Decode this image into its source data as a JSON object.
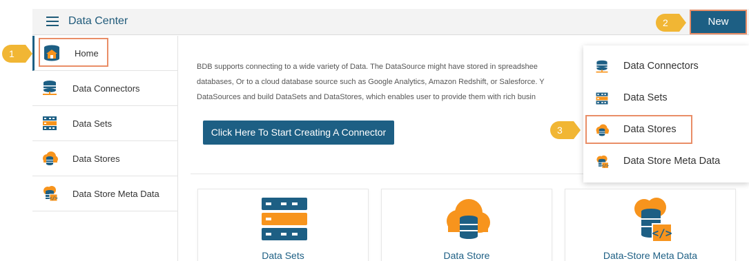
{
  "header": {
    "title": "Data Center",
    "new_button": "New"
  },
  "callouts": [
    "1",
    "2",
    "3"
  ],
  "sidebar": {
    "items": [
      {
        "label": "Home",
        "icon": "home-db-icon",
        "active": true
      },
      {
        "label": "Data Connectors",
        "icon": "data-connectors-icon"
      },
      {
        "label": "Data Sets",
        "icon": "data-sets-icon"
      },
      {
        "label": "Data Stores",
        "icon": "data-stores-icon"
      },
      {
        "label": "Data Store Meta Data",
        "icon": "data-store-meta-icon"
      }
    ]
  },
  "main": {
    "intro_lines": [
      "BDB supports connecting to a wide variety of Data. The DataSource might have stored in spreadshee",
      "databases, Or to a cloud database source such as Google Analytics, Amazon Redshift, or Salesforce. Y",
      "DataSources and build DataSets and DataStores, which enables user to provide them with rich busin"
    ],
    "cta_label": "Click Here To Start Creating A Connector",
    "cards": [
      {
        "label": "Data Sets",
        "icon": "data-sets-icon"
      },
      {
        "label": "Data Store",
        "icon": "data-store-icon"
      },
      {
        "label": "Data-Store Meta Data",
        "icon": "data-store-meta-icon"
      }
    ]
  },
  "new_menu": {
    "items": [
      {
        "label": "Data Connectors",
        "icon": "data-connectors-icon"
      },
      {
        "label": "Data Sets",
        "icon": "data-sets-icon"
      },
      {
        "label": "Data Stores",
        "icon": "data-stores-icon"
      },
      {
        "label": "Data Store Meta Data",
        "icon": "data-store-meta-icon"
      }
    ]
  },
  "colors": {
    "primary": "#1d5f84",
    "accent_orange": "#f7941d",
    "highlight": "#e98d66",
    "callout": "#f1b634"
  }
}
